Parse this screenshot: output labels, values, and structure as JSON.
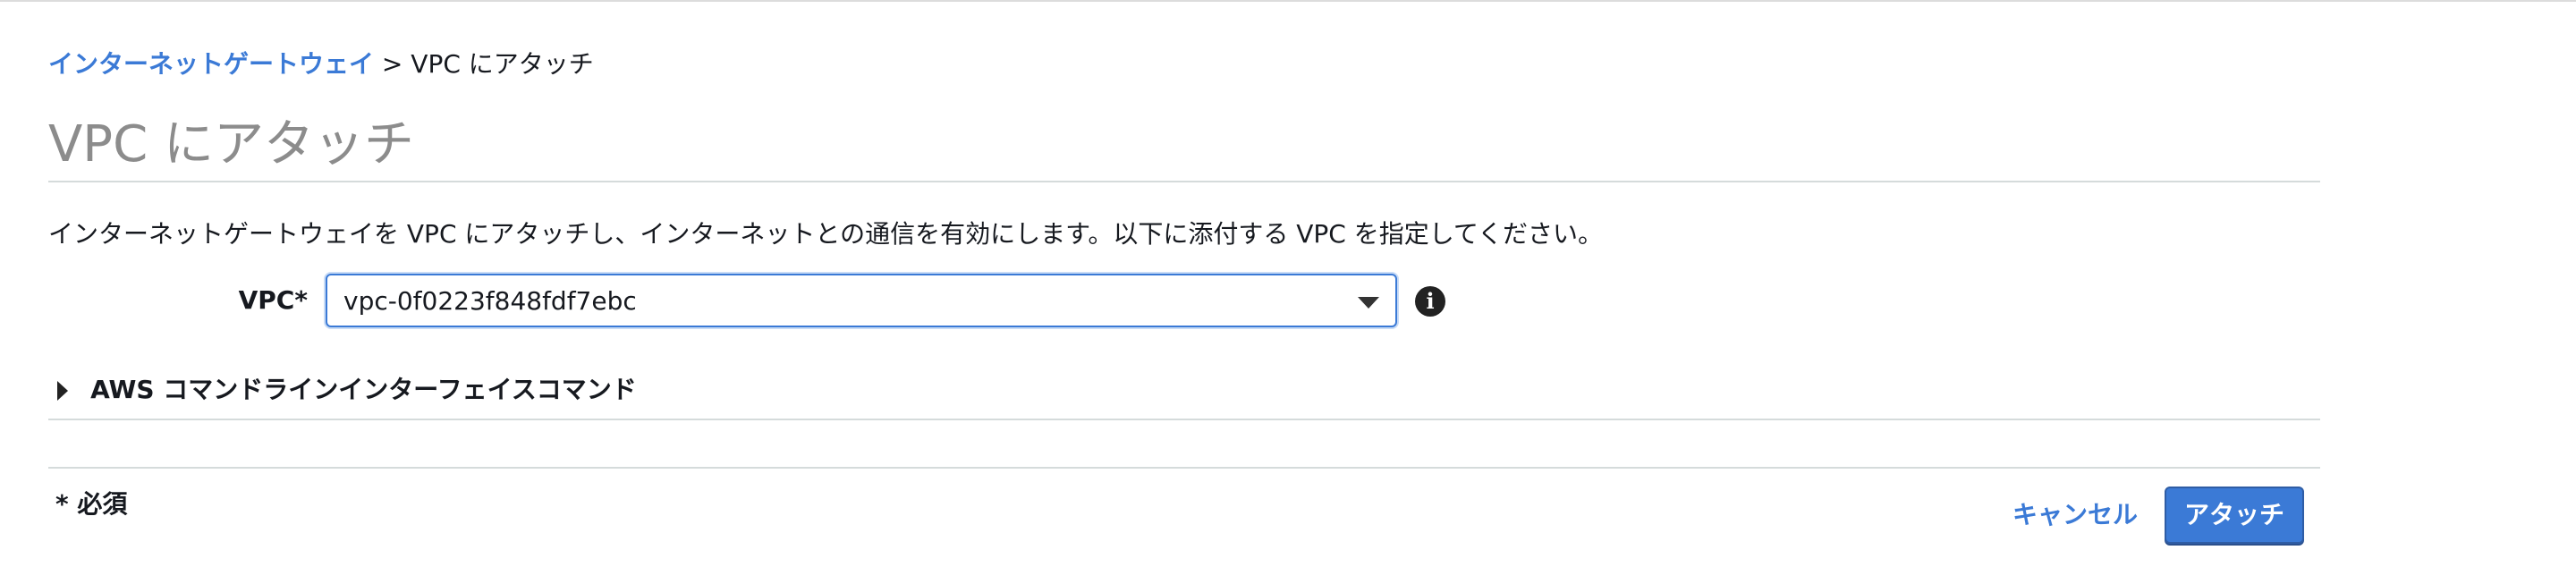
{
  "breadcrumb": {
    "parent": "インターネットゲートウェイ",
    "separator": ">",
    "current": "VPC にアタッチ"
  },
  "page": {
    "title": "VPC にアタッチ",
    "description": "インターネットゲートウェイを VPC にアタッチし、インターネットとの通信を有効にします。以下に添付する VPC を指定してください。"
  },
  "form": {
    "vpc_label": "VPC*",
    "vpc_value": "vpc-0f0223f848fdf7ebc",
    "info_icon": "i"
  },
  "cli": {
    "label": "AWS コマンドラインインターフェイスコマンド"
  },
  "footer": {
    "required_note": "* 必須",
    "cancel_label": "キャンセル",
    "attach_label": "アタッチ"
  },
  "colors": {
    "accent": "#3b7ad6",
    "text": "#16191f",
    "title": "#8c8c8c",
    "divider": "#d5dbdb"
  }
}
